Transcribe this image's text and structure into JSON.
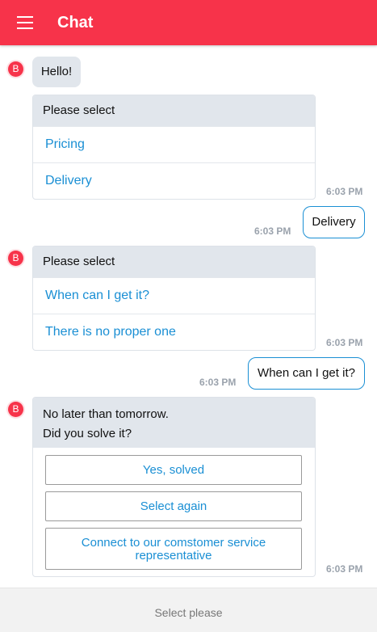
{
  "header": {
    "title": "Chat",
    "menu_icon": "hamburger-menu-icon",
    "color": "#f7334a"
  },
  "avatar": {
    "letter": "B"
  },
  "messages": [
    {
      "text": "Hello!"
    },
    {
      "title": "Please select",
      "options": [
        "Pricing",
        "Delivery"
      ],
      "time": "6:03 PM"
    },
    {
      "user_text": "Delivery",
      "time": "6:03 PM"
    },
    {
      "title": "Please select",
      "options": [
        "When can I get it?",
        "There is no proper one"
      ],
      "time": "6:03 PM"
    },
    {
      "user_text": "When can I get it?",
      "time": "6:03 PM"
    },
    {
      "lines": [
        "No later than tomorrow.",
        "Did you solve it?"
      ],
      "buttons": [
        "Yes, solved",
        "Select again",
        "Connect to our comstomer service representative"
      ],
      "time": "6:03 PM"
    }
  ],
  "footer": {
    "placeholder": "Select please"
  },
  "colors": {
    "accent": "#f7334a",
    "link": "#1a8fd4",
    "bubble": "#e1e6ec"
  }
}
